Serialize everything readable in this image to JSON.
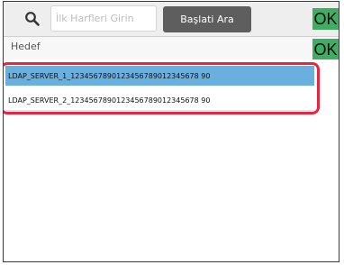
{
  "toolbar": {
    "search_placeholder": "İlk Harfleri Girin",
    "start_search_label": "Başlati Ara",
    "ok_label": "OK"
  },
  "panel": {
    "destination_label": "Hedef",
    "ok_label": "OK"
  },
  "servers": [
    "LDAP_SERVER_1_1234567890123456789012345678 90",
    "LDAP_SERVER_2_1234567890123456789012345678 90"
  ]
}
